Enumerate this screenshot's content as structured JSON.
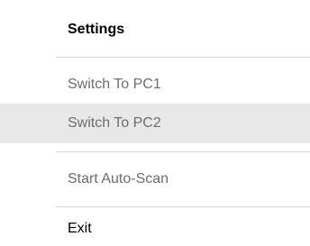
{
  "menu": {
    "items": [
      {
        "label": "Settings",
        "style": "bold",
        "enabled": true
      },
      {
        "label": "Switch To PC1",
        "style": "normal",
        "enabled": false
      },
      {
        "label": "Switch To PC2",
        "style": "normal",
        "enabled": false,
        "highlighted": true
      },
      {
        "label": "Start Auto-Scan",
        "style": "normal",
        "enabled": false
      },
      {
        "label": "Exit",
        "style": "normal",
        "enabled": true
      }
    ]
  },
  "colors": {
    "background": "#ffffff",
    "highlight": "#e8e8e8",
    "disabled_text": "#6d6d6d",
    "separator": "#d7d7d7"
  }
}
